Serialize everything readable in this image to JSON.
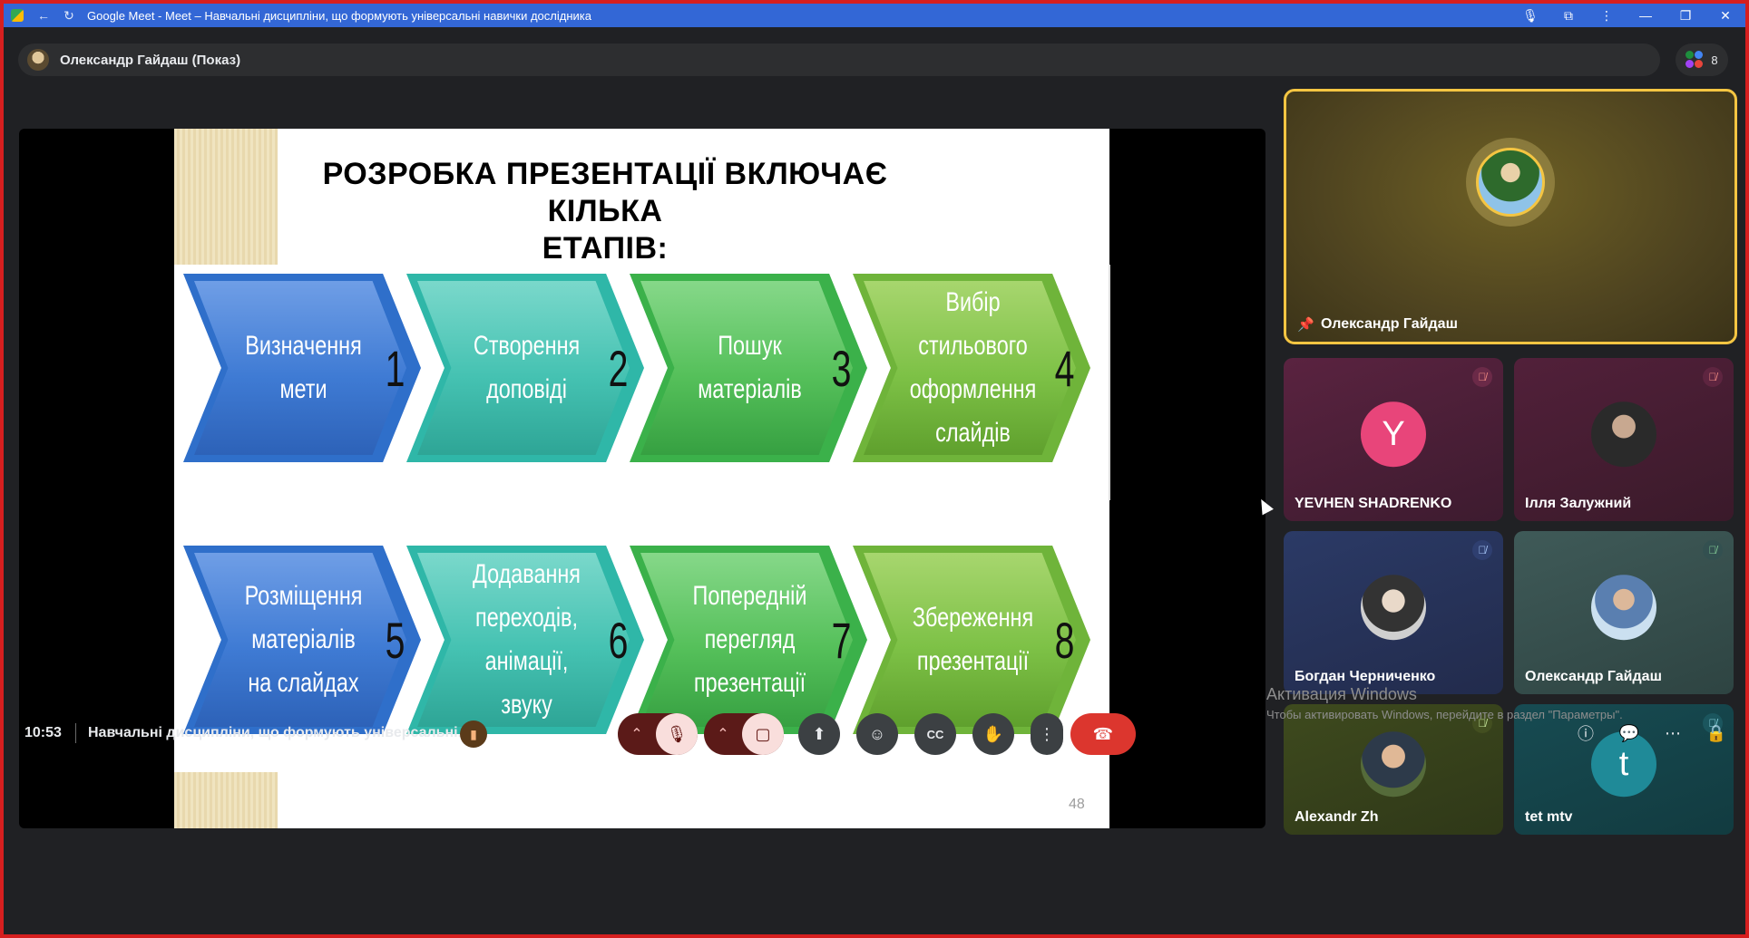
{
  "browser": {
    "title": "Google Meet - Meet – Навчальні дисципліни, що формують універсальні навички дослідника",
    "back_icon": "←",
    "reload_icon": "↻",
    "mic_icon": "🎙",
    "ext_icon": "⧉",
    "menu_icon": "⋮",
    "min_icon": "—",
    "restore_icon": "❐",
    "close_icon": "✕"
  },
  "presenter_bar": {
    "label": "Олександр Гайдаш (Показ)"
  },
  "people": {
    "count": "8"
  },
  "slide": {
    "title_line1": "РОЗРОБКА ПРЕЗЕНТАЦІЇ ВКЛЮЧАЄ КІЛЬКА",
    "title_line2": "ЕТАПІВ:",
    "page_number": "48",
    "steps": [
      {
        "text": "Визначення мети",
        "num": "1"
      },
      {
        "text": "Створення доповіді",
        "num": "2"
      },
      {
        "text": "Пошук матеріалів",
        "num": "3"
      },
      {
        "text": "Вибір стильового оформлення слайдів",
        "num": "4"
      },
      {
        "text": "Розміщення матеріалів на слайдах",
        "num": "5"
      },
      {
        "text": "Додавання переходів, анімації, звуку",
        "num": "6"
      },
      {
        "text": "Попередній перегляд презентації",
        "num": "7"
      },
      {
        "text": "Збереження презентації",
        "num": "8"
      }
    ]
  },
  "tiles": {
    "main": {
      "name": "Олександр Гайдаш",
      "pin_icon": "📌"
    },
    "t1": {
      "name": "YEVHEN SHADRENKO",
      "letter": "Y"
    },
    "t2": {
      "name": "Ілля Залужний"
    },
    "t3": {
      "name": "Богдан Черниченко"
    },
    "t4": {
      "name": "Олександр Гайдаш"
    },
    "t5": {
      "name": "Alexandr Zh"
    },
    "t6": {
      "name": "tet mtv",
      "letter": "t"
    },
    "mic_off_icon": "🎙̸"
  },
  "bottom": {
    "time": "10:53",
    "meeting_name": "Навчальні дисципліни, що формують універсальні...",
    "activation_title": "Активация Windows",
    "activation_text": "Чтобы активировать Windows, перейдите в раздел \"Параметры\".",
    "icons": {
      "chevron_up": "⌃",
      "mic_off": "🎙",
      "cam_off": "▢",
      "present": "⬆",
      "emoji": "☺",
      "captions": "CC",
      "raise_hand": "✋",
      "more": "⋮",
      "end_call": "☎",
      "info": "ⓘ",
      "chat": "💬",
      "activities": "⋯",
      "lock": "🔒"
    }
  }
}
